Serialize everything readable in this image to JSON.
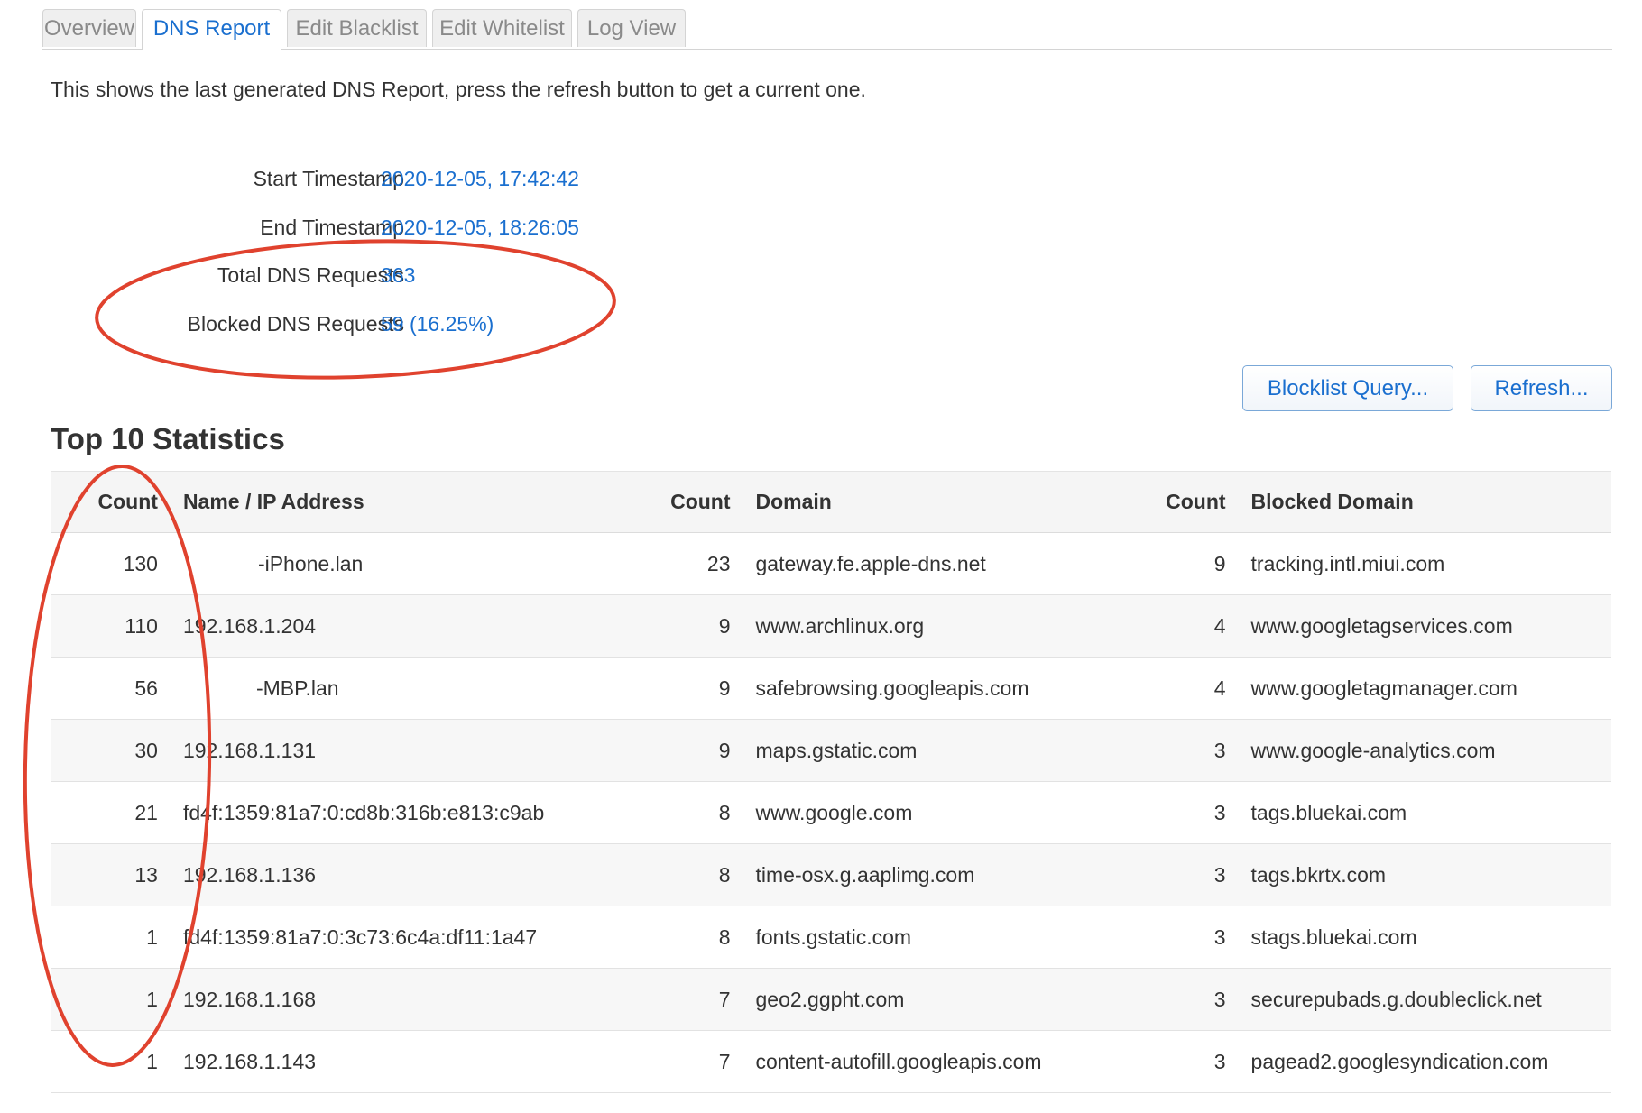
{
  "tabs": [
    {
      "label": "Overview",
      "active": false
    },
    {
      "label": "DNS Report",
      "active": true
    },
    {
      "label": "Edit Blacklist",
      "active": false
    },
    {
      "label": "Edit Whitelist",
      "active": false
    },
    {
      "label": "Log View",
      "active": false
    }
  ],
  "intro": "This shows the last generated DNS Report, press the refresh button to get a current one.",
  "info": {
    "start_label": "Start Timestamp",
    "start_value": "2020-12-05, 17:42:42",
    "end_label": "End Timestamp",
    "end_value": "2020-12-05, 18:26:05",
    "total_label": "Total DNS Requests",
    "total_value": "363",
    "blocked_label": "Blocked DNS Requests",
    "blocked_value": "59 (16.25%)"
  },
  "buttons": {
    "blocklist_query": "Blocklist Query...",
    "refresh": "Refresh..."
  },
  "section_title": "Top 10 Statistics",
  "table": {
    "headers": [
      "Count",
      "Name / IP Address",
      "Count",
      "Domain",
      "Count",
      "Blocked Domain"
    ],
    "rows": [
      {
        "c1": "130",
        "name": "-iPhone.lan",
        "c2": "23",
        "domain": "gateway.fe.apple-dns.net",
        "c3": "9",
        "blocked": "tracking.intl.miui.com"
      },
      {
        "c1": "110",
        "name": "192.168.1.204",
        "c2": "9",
        "domain": "www.archlinux.org",
        "c3": "4",
        "blocked": "www.googletagservices.com"
      },
      {
        "c1": "56",
        "name": "-MBP.lan",
        "c2": "9",
        "domain": "safebrowsing.googleapis.com",
        "c3": "4",
        "blocked": "www.googletagmanager.com"
      },
      {
        "c1": "30",
        "name": "192.168.1.131",
        "c2": "9",
        "domain": "maps.gstatic.com",
        "c3": "3",
        "blocked": "www.google-analytics.com"
      },
      {
        "c1": "21",
        "name": "fd4f:1359:81a7:0:cd8b:316b:e813:c9ab",
        "c2": "8",
        "domain": "www.google.com",
        "c3": "3",
        "blocked": "tags.bluekai.com"
      },
      {
        "c1": "13",
        "name": "192.168.1.136",
        "c2": "8",
        "domain": "time-osx.g.aaplimg.com",
        "c3": "3",
        "blocked": "tags.bkrtx.com"
      },
      {
        "c1": "1",
        "name": "fd4f:1359:81a7:0:3c73:6c4a:df11:1a47",
        "c2": "8",
        "domain": "fonts.gstatic.com",
        "c3": "3",
        "blocked": "stags.bluekai.com"
      },
      {
        "c1": "1",
        "name": "192.168.1.168",
        "c2": "7",
        "domain": "geo2.ggpht.com",
        "c3": "3",
        "blocked": "securepubads.g.doubleclick.net"
      },
      {
        "c1": "1",
        "name": "192.168.1.143",
        "c2": "7",
        "domain": "content-autofill.googleapis.com",
        "c3": "3",
        "blocked": "pagead2.googlesyndication.com"
      }
    ]
  },
  "colors": {
    "link": "#1a6fcf",
    "annotation": "#e0422e",
    "header_bg": "#f5f5f5"
  }
}
